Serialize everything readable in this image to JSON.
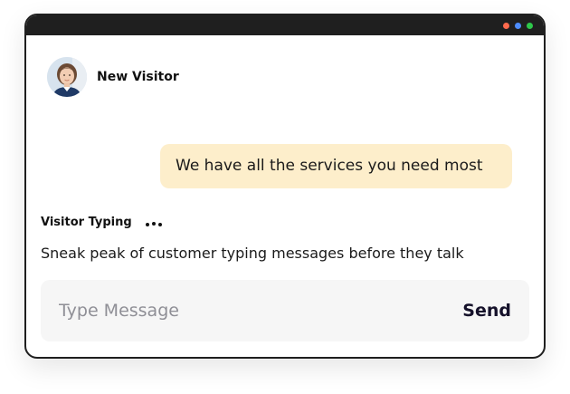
{
  "window": {
    "controls": [
      {
        "name": "close",
        "color": "#ff6a4d"
      },
      {
        "name": "minimize",
        "color": "#4d8dff"
      },
      {
        "name": "maximize",
        "color": "#2ec84a"
      }
    ]
  },
  "header": {
    "visitor_name": "New Visitor",
    "avatar_icon": "visitor-avatar"
  },
  "message": {
    "text": "We have all the services you need most",
    "bubble_color": "#fdeecb"
  },
  "typing": {
    "label": "Visitor Typing",
    "indicator_icon": "typing-dots-icon",
    "preview_text": "Sneak peak of customer typing messages before they talk"
  },
  "composer": {
    "placeholder": "Type Message",
    "value": "",
    "send_label": "Send"
  }
}
